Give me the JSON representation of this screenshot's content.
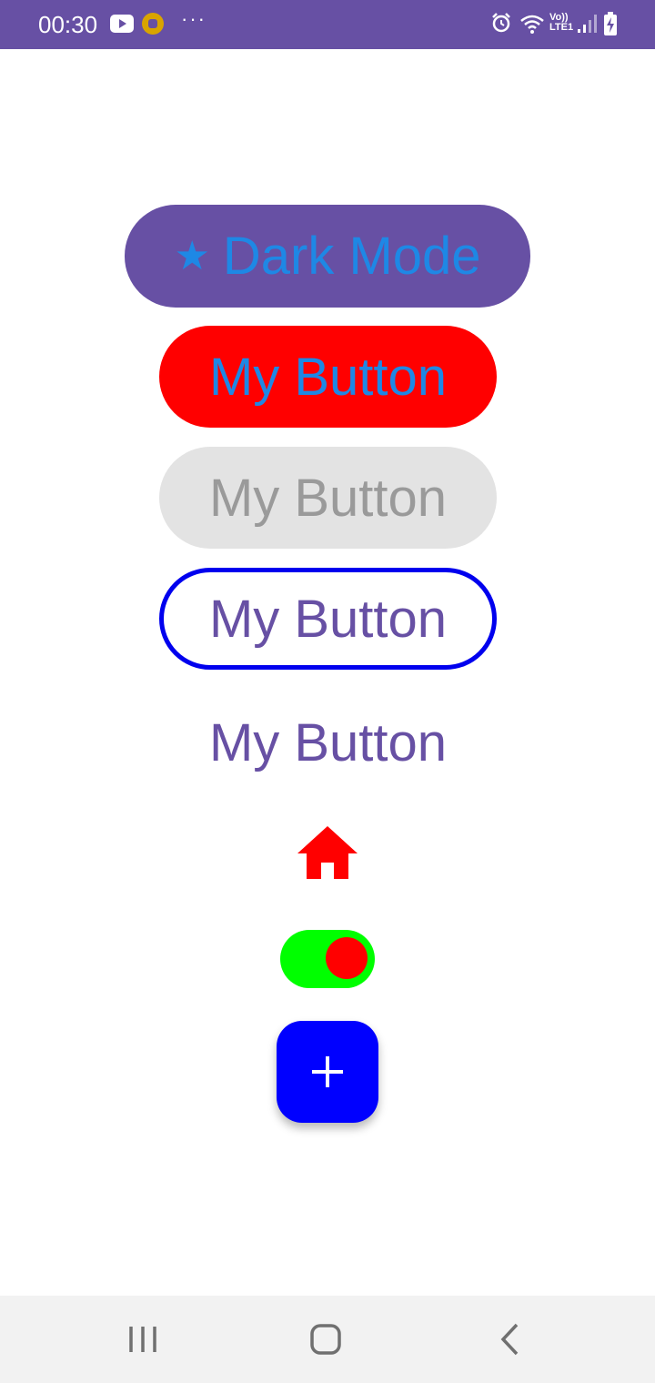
{
  "status_bar": {
    "time": "00:30",
    "more_indicator": "···",
    "network_label_top": "Vo))",
    "network_label_bottom": "LTE1",
    "background_color": "#6750a4",
    "icons": [
      "youtube-icon",
      "coin-app-icon",
      "alarm-icon",
      "wifi-icon",
      "signal-icon",
      "battery-charging-icon"
    ]
  },
  "buttons": {
    "dark_mode": {
      "icon": "star-icon",
      "star_glyph": "★",
      "label": "Dark Mode"
    },
    "red": {
      "label": "My Button"
    },
    "disabled": {
      "label": "My Button"
    },
    "outlined": {
      "label": "My Button"
    },
    "text": {
      "label": "My Button"
    }
  },
  "home_icon": {
    "icon": "home-icon",
    "color": "#ff0000"
  },
  "toggle": {
    "checked": true,
    "track_color": "#00ff00",
    "thumb_color": "#ff0000"
  },
  "fab": {
    "icon": "add-icon",
    "color": "#0000ff"
  },
  "nav_bar": {
    "icons": [
      "recent-apps-icon",
      "home-nav-icon",
      "back-icon"
    ]
  }
}
